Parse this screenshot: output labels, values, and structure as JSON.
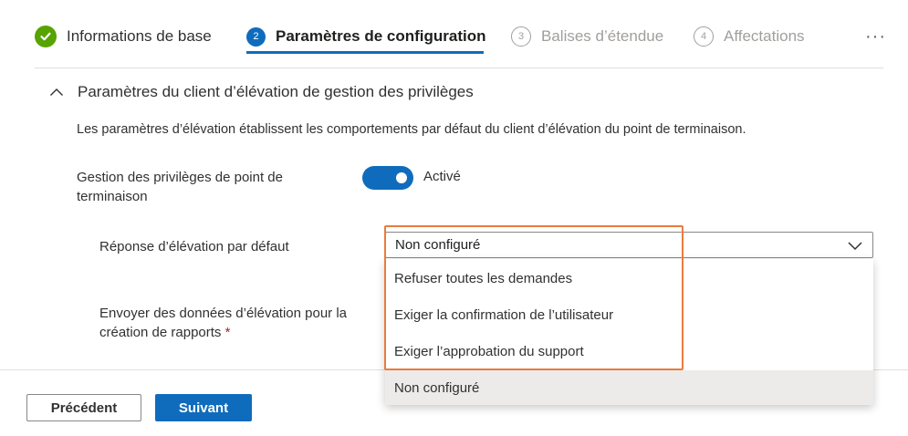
{
  "wizard": {
    "steps": [
      {
        "number": "",
        "label": "Informations de base",
        "state": "completed"
      },
      {
        "number": "2",
        "label": "Paramètres de configuration",
        "state": "current"
      },
      {
        "number": "3",
        "label": "Balises d’étendue",
        "state": "upcoming"
      },
      {
        "number": "4",
        "label": "Affectations",
        "state": "upcoming"
      }
    ],
    "more_label": "···"
  },
  "section": {
    "title": "Paramètres du client d’élévation de gestion des privilèges",
    "description": "Les paramètres d’élévation établissent les comportements par défaut du client d’élévation du point de terminaison."
  },
  "settings": {
    "epm_label": "Gestion des privilèges de point de terminaison",
    "epm_toggle_state": "Activé",
    "default_response_label": "Réponse d’élévation par défaut",
    "default_response_value": "Non configuré",
    "report_label": "Envoyer des données d’élévation pour la création de rapports",
    "required_marker": "*"
  },
  "dropdown_options": [
    "Refuser toutes les demandes",
    "Exiger la confirmation de l’utilisateur",
    "Exiger l’approbation du support",
    "Non configuré"
  ],
  "footer": {
    "prev_label": "Précédent",
    "next_label": "Suivant"
  },
  "colors": {
    "accent": "#0f6cbd",
    "success": "#57a300",
    "highlight": "#e87c3e"
  }
}
